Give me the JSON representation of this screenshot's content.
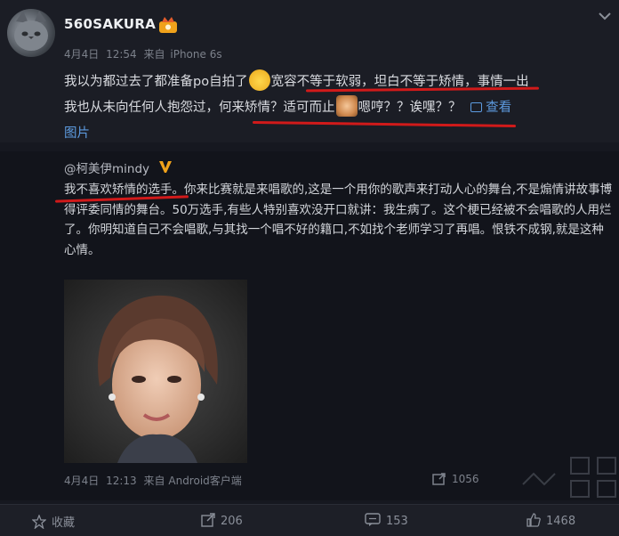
{
  "post": {
    "username": "560SAKURA",
    "date": "4月4日",
    "time": "12:54",
    "via": "来自",
    "device": "iPhone 6s",
    "line1_a": "我以为都过去了都准备po自拍了",
    "line1_b": "宽容不等于软弱，坦白不等于矫情，事情一出",
    "line2_a": "我也从未向任何人抱怨过，何来矫情？适可而止",
    "line2_b": "嗯哼？？诶嘿？？",
    "view_pic": "查看",
    "line3": "图片",
    "emoji_1": "cat-face-emoji",
    "emoji_2": "monkey-emoji"
  },
  "repost": {
    "author": "@柯美伊mindy",
    "text": "我不喜欢矫情的选手。你来比赛就是来唱歌的,这是一个用你的歌声来打动人心的舞台,不是煽情讲故事博得评委同情的舞台。50万选手,有些人特别喜欢没开口就讲：我生病了。这个梗已经被不会唱歌的人用烂了。你明知道自己不会唱歌,与其找一个唱不好的籍口,不如找个老师学习了再唱。恨铁不成钢,就是这种心情。",
    "date": "4月4日",
    "time": "12:13",
    "via": "来自",
    "client": "Android客户端",
    "shares": "1056"
  },
  "footer": {
    "favorite": "收藏",
    "reposts": "206",
    "comments": "153",
    "likes": "1468"
  },
  "colors": {
    "accent_link": "#5d9be0",
    "underline_red": "#d11a1a",
    "verified_gold": "#f0a21b"
  }
}
